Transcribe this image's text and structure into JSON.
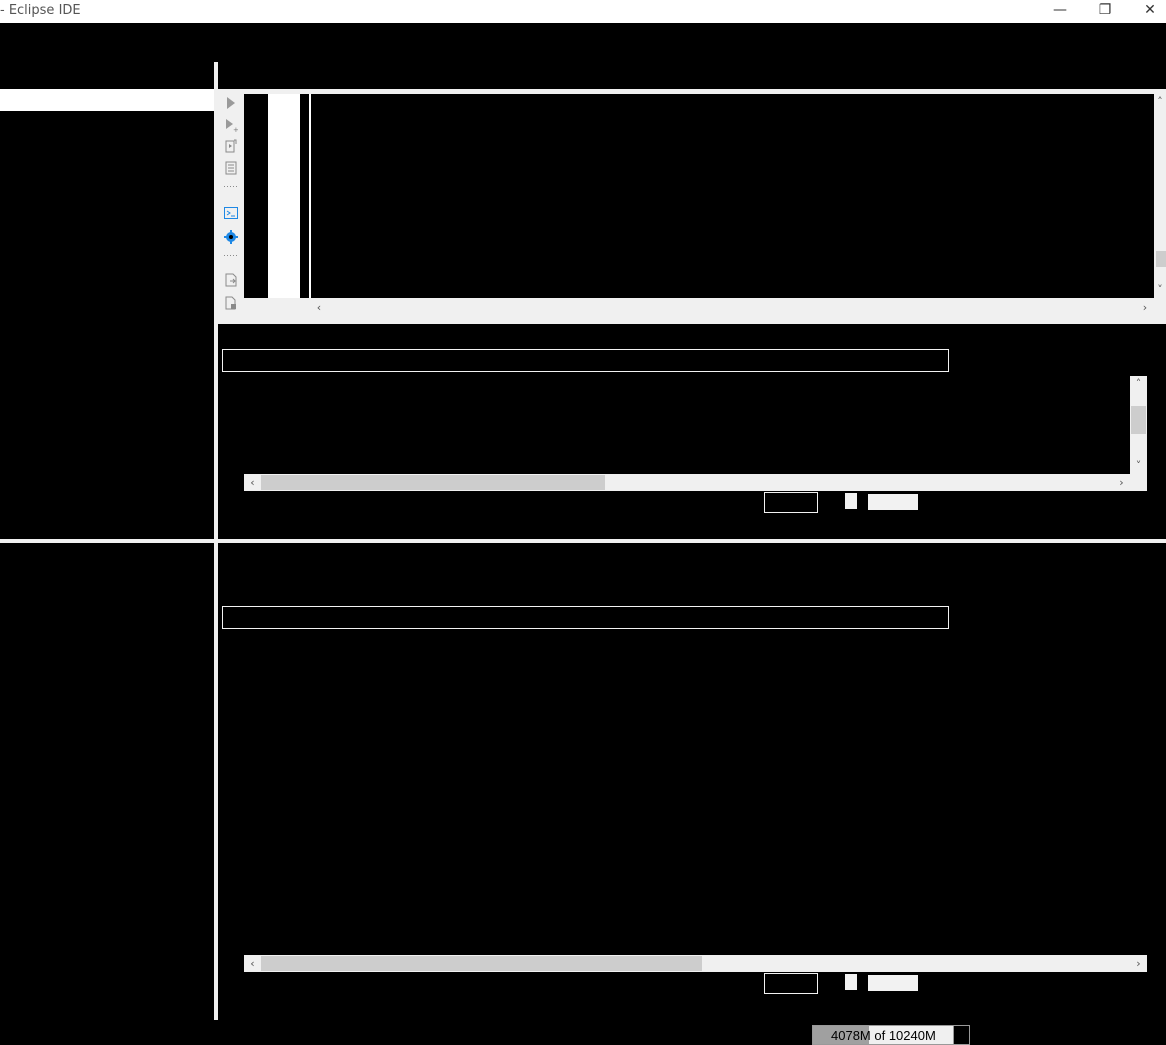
{
  "window": {
    "title": "- Eclipse IDE",
    "minimize_glyph": "—",
    "restore_glyph": "❐",
    "close_glyph": "✕"
  },
  "console_toolbar": {
    "icons": [
      "run-icon",
      "run-add-icon",
      "debug-file-icon",
      "document-icon",
      "separator-dots",
      "terminal-icon",
      "gear-icon",
      "separator-dots",
      "export-icon",
      "file-lock-icon"
    ]
  },
  "scroll_arrows": {
    "left": "‹",
    "right": "›",
    "up": "˄",
    "down": "˅"
  },
  "status_bar": {
    "heap_label": "4078M of 10240M",
    "heap_fraction": 0.398
  },
  "colors": {
    "background": "#000000",
    "chrome": "#f0f0f0",
    "accent": "#1e88e5"
  }
}
